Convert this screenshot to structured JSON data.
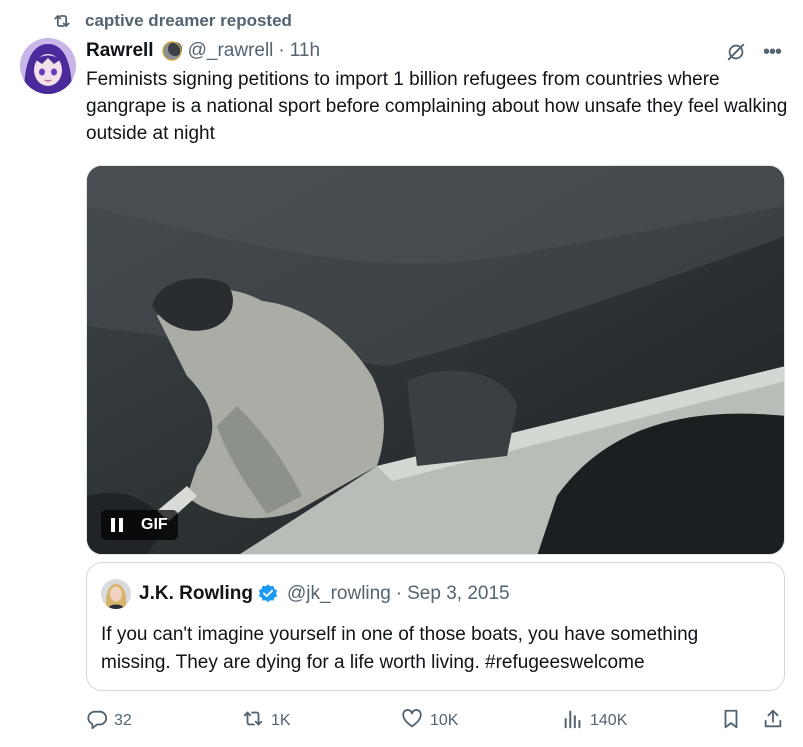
{
  "repost": {
    "label": "captive dreamer reposted",
    "icon": "repost-icon"
  },
  "tweet": {
    "author_name": "Rawrell",
    "author_handle": "@_rawrell",
    "separator": "·",
    "time": "11h",
    "text": "Feminists signing petitions to import 1 billion refugees from countries where gangrape is a national sport before complaining about how unsafe they feel walking outside at night",
    "media": {
      "badge": "GIF",
      "icons": [
        "pause-icon"
      ]
    },
    "header_icons": [
      "grok-icon",
      "more-icon"
    ]
  },
  "quote": {
    "author_name": "J.K. Rowling",
    "author_handle": "@jk_rowling",
    "separator": "·",
    "date": "Sep 3, 2015",
    "text": "If you can't imagine yourself in one of those boats, you have something missing. They are dying for a life worth living. #refugeeswelcome",
    "verified_icon": "verified-badge-icon"
  },
  "actions": {
    "replies": "32",
    "reposts": "1K",
    "likes": "10K",
    "views": "140K",
    "icons": [
      "reply-icon",
      "repost-icon",
      "like-icon",
      "views-icon",
      "bookmark-icon",
      "share-icon"
    ]
  },
  "colors": {
    "text": "#0f1419",
    "secondary": "#536471",
    "verified": "#1d9bf0",
    "border": "#cfd9de"
  }
}
